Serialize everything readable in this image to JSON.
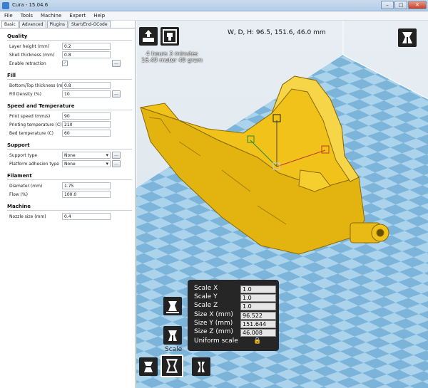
{
  "window": {
    "title": "Cura - 15.04.6",
    "min": "–",
    "max": "□",
    "close": "✕"
  },
  "menu": [
    "File",
    "Tools",
    "Machine",
    "Expert",
    "Help"
  ],
  "tabs": [
    "Basic",
    "Advanced",
    "Plugins",
    "Start/End-GCode"
  ],
  "sections": {
    "quality": {
      "title": "Quality",
      "layer_height": {
        "label": "Layer height (mm)",
        "value": "0.2"
      },
      "shell_thickness": {
        "label": "Shell thickness (mm)",
        "value": "0.8"
      },
      "retraction": {
        "label": "Enable retraction",
        "checked": "✓",
        "more": "..."
      }
    },
    "fill": {
      "title": "Fill",
      "bottom_top": {
        "label": "Bottom/Top thickness (mm)",
        "value": "0.8"
      },
      "density": {
        "label": "Fill Density (%)",
        "value": "10",
        "more": "..."
      }
    },
    "speed": {
      "title": "Speed and Temperature",
      "print_speed": {
        "label": "Print speed (mm/s)",
        "value": "90"
      },
      "print_temp": {
        "label": "Printing temperature (C)",
        "value": "210"
      },
      "bed_temp": {
        "label": "Bed temperature (C)",
        "value": "60"
      }
    },
    "support": {
      "title": "Support",
      "support_type": {
        "label": "Support type",
        "value": "None",
        "more": "..."
      },
      "adhesion": {
        "label": "Platform adhesion type",
        "value": "None",
        "more": "..."
      }
    },
    "filament": {
      "title": "Filament",
      "diameter": {
        "label": "Diameter (mm)",
        "value": "1.75"
      },
      "flow": {
        "label": "Flow (%)",
        "value": "100.0"
      }
    },
    "machine": {
      "title": "Machine",
      "nozzle": {
        "label": "Nozzle size (mm)",
        "value": "0.4"
      }
    }
  },
  "viewport": {
    "dimensions": "W, D, H: 96.5, 151.6, 46.0 mm",
    "time": "4 hours 3 minutes",
    "material": "16.49 meter 49 gram",
    "model_color": "#f0c21a",
    "platform_color": "#7fb6d8"
  },
  "scale": {
    "caption": "Scale",
    "x": {
      "label": "Scale X",
      "value": "1.0"
    },
    "y": {
      "label": "Scale Y",
      "value": "1.0"
    },
    "z": {
      "label": "Scale Z",
      "value": "1.0"
    },
    "x_mm": {
      "label": "Size X (mm)",
      "value": "96.522"
    },
    "y_mm": {
      "label": "Size Y (mm)",
      "value": "151.644"
    },
    "z_mm": {
      "label": "Size Z (mm)",
      "value": "46.008"
    },
    "uniform": {
      "label": "Uniform scale",
      "icon": "🔒"
    }
  }
}
